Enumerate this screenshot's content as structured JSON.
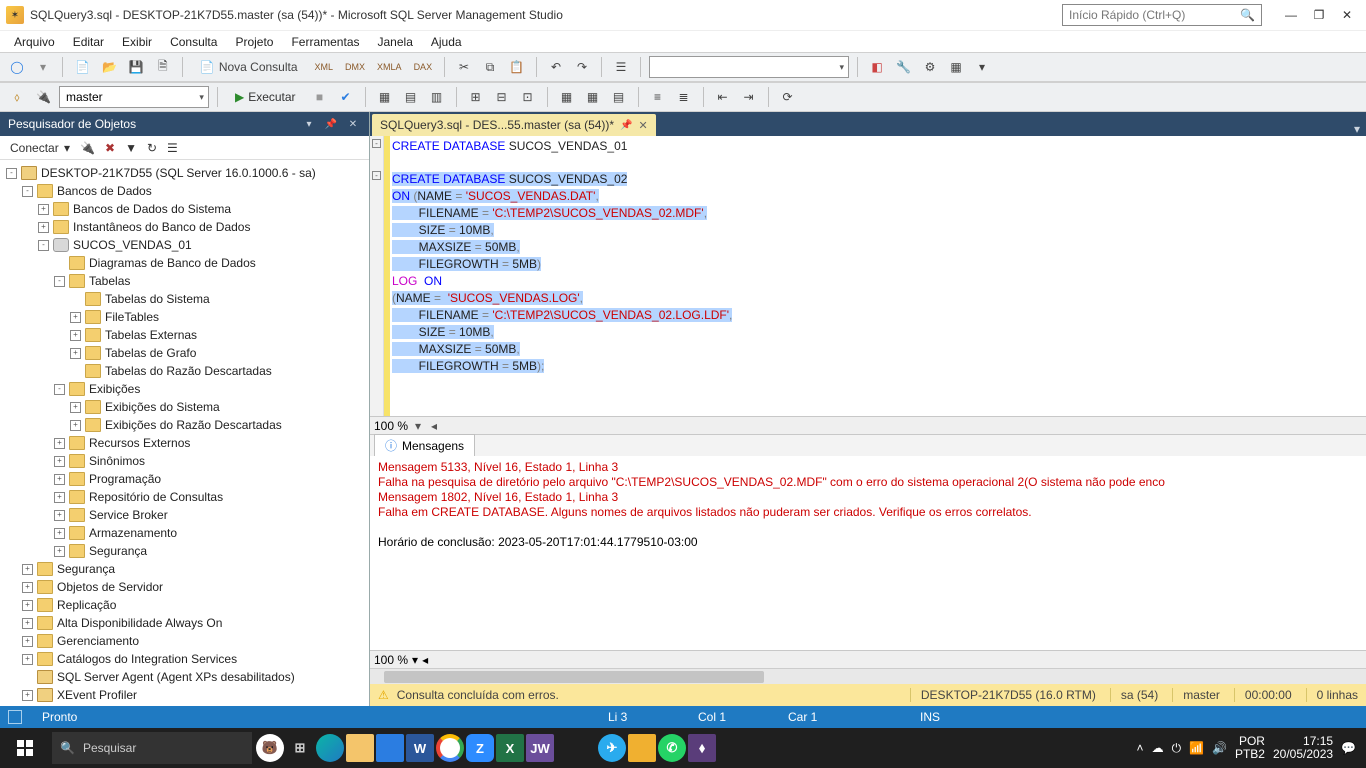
{
  "title": "SQLQuery3.sql - DESKTOP-21K7D55.master (sa (54))* - Microsoft SQL Server Management Studio",
  "quick_launch_placeholder": "Início Rápido (Ctrl+Q)",
  "menu": [
    "Arquivo",
    "Editar",
    "Exibir",
    "Consulta",
    "Projeto",
    "Ferramentas",
    "Janela",
    "Ajuda"
  ],
  "toolbar": {
    "new_query": "Nova Consulta",
    "execute": "Executar"
  },
  "db_combo": "master",
  "obj_explorer": {
    "title": "Pesquisador de Objetos",
    "connect": "Conectar",
    "tree": [
      {
        "pad": 0,
        "exp": "-",
        "icon": "srv",
        "label": "DESKTOP-21K7D55 (SQL Server 16.0.1000.6 - sa)"
      },
      {
        "pad": 1,
        "exp": "-",
        "icon": "f",
        "label": "Bancos de Dados"
      },
      {
        "pad": 2,
        "exp": "+",
        "icon": "f",
        "label": "Bancos de Dados do Sistema"
      },
      {
        "pad": 2,
        "exp": "+",
        "icon": "f",
        "label": "Instantâneos do Banco de Dados"
      },
      {
        "pad": 2,
        "exp": "-",
        "icon": "db",
        "label": "SUCOS_VENDAS_01"
      },
      {
        "pad": 3,
        "exp": "",
        "icon": "f",
        "label": "Diagramas de Banco de Dados"
      },
      {
        "pad": 3,
        "exp": "-",
        "icon": "f",
        "label": "Tabelas"
      },
      {
        "pad": 4,
        "exp": "",
        "icon": "f",
        "label": "Tabelas do Sistema"
      },
      {
        "pad": 4,
        "exp": "+",
        "icon": "f",
        "label": "FileTables"
      },
      {
        "pad": 4,
        "exp": "+",
        "icon": "f",
        "label": "Tabelas Externas"
      },
      {
        "pad": 4,
        "exp": "+",
        "icon": "f",
        "label": "Tabelas de Grafo"
      },
      {
        "pad": 4,
        "exp": "",
        "icon": "f",
        "label": "Tabelas do Razão Descartadas"
      },
      {
        "pad": 3,
        "exp": "-",
        "icon": "f",
        "label": "Exibições"
      },
      {
        "pad": 4,
        "exp": "+",
        "icon": "f",
        "label": "Exibições do Sistema"
      },
      {
        "pad": 4,
        "exp": "+",
        "icon": "f",
        "label": "Exibições do Razão Descartadas"
      },
      {
        "pad": 3,
        "exp": "+",
        "icon": "f",
        "label": "Recursos Externos"
      },
      {
        "pad": 3,
        "exp": "+",
        "icon": "f",
        "label": "Sinônimos"
      },
      {
        "pad": 3,
        "exp": "+",
        "icon": "f",
        "label": "Programação"
      },
      {
        "pad": 3,
        "exp": "+",
        "icon": "f",
        "label": "Repositório de Consultas"
      },
      {
        "pad": 3,
        "exp": "+",
        "icon": "f",
        "label": "Service Broker"
      },
      {
        "pad": 3,
        "exp": "+",
        "icon": "f",
        "label": "Armazenamento"
      },
      {
        "pad": 3,
        "exp": "+",
        "icon": "f",
        "label": "Segurança"
      },
      {
        "pad": 1,
        "exp": "+",
        "icon": "f",
        "label": "Segurança"
      },
      {
        "pad": 1,
        "exp": "+",
        "icon": "f",
        "label": "Objetos de Servidor"
      },
      {
        "pad": 1,
        "exp": "+",
        "icon": "f",
        "label": "Replicação"
      },
      {
        "pad": 1,
        "exp": "+",
        "icon": "f",
        "label": "Alta Disponibilidade Always On"
      },
      {
        "pad": 1,
        "exp": "+",
        "icon": "f",
        "label": "Gerenciamento"
      },
      {
        "pad": 1,
        "exp": "+",
        "icon": "f",
        "label": "Catálogos do Integration Services"
      },
      {
        "pad": 1,
        "exp": "",
        "icon": "srv",
        "label": "SQL Server Agent (Agent XPs desabilitados)"
      },
      {
        "pad": 1,
        "exp": "+",
        "icon": "srv",
        "label": "XEvent Profiler"
      }
    ]
  },
  "doc_tab": "SQLQuery3.sql - DES...55.master (sa (54))*",
  "code": {
    "l1": {
      "a": "CREATE DATABASE",
      "b": " SUCOS_VENDAS_01"
    },
    "l3": {
      "a": "CREATE DATABASE",
      "b": " SUCOS_VENDAS_02"
    },
    "l4": {
      "a": "ON ",
      "b": "(",
      "c": "NAME ",
      "d": "=",
      "e": " 'SUCOS_VENDAS.DAT'",
      "f": ","
    },
    "l5": {
      "a": "        FILENAME ",
      "b": "=",
      "c": " 'C:\\TEMP2\\SUCOS_VENDAS_02.MDF'",
      "d": ","
    },
    "l6": {
      "a": "        SIZE ",
      "b": "=",
      "c": " 10MB",
      "d": ","
    },
    "l7": {
      "a": "        MAXSIZE ",
      "b": "=",
      "c": " 50MB",
      "d": ","
    },
    "l8": {
      "a": "        FILEGROWTH ",
      "b": "=",
      "c": " 5MB",
      "d": ")"
    },
    "l9": {
      "a": "LOG",
      "b": "  ON"
    },
    "l10": {
      "a": "(",
      "b": "NAME ",
      "c": "=",
      "d": "  'SUCOS_VENDAS.LOG'",
      "e": ","
    },
    "l11": {
      "a": "        FILENAME ",
      "b": "=",
      "c": " 'C:\\TEMP2\\SUCOS_VENDAS_02.LOG.LDF'",
      "d": ","
    },
    "l12": {
      "a": "        SIZE ",
      "b": "=",
      "c": " 10MB",
      "d": ","
    },
    "l13": {
      "a": "        MAXSIZE ",
      "b": "=",
      "c": " 50MB",
      "d": ","
    },
    "l14": {
      "a": "        FILEGROWTH ",
      "b": "=",
      "c": " 5MB",
      "d": ");"
    }
  },
  "zoom": "100 %",
  "messages_tab": "Mensagens",
  "messages": {
    "l1": "Mensagem 5133, Nível 16, Estado 1, Linha 3",
    "l2": "Falha na pesquisa de diretório pelo arquivo \"C:\\TEMP2\\SUCOS_VENDAS_02.MDF\" com o erro do sistema operacional 2(O sistema não pode enco",
    "l3": "Mensagem 1802, Nível 16, Estado 1, Linha 3",
    "l4": "Falha em CREATE DATABASE. Alguns nomes de arquivos listados não puderam ser criados. Verifique os erros correlatos.",
    "l5": "",
    "l6": "Horário de conclusão: 2023-05-20T17:01:44.1779510-03:00"
  },
  "query_status": {
    "text": "Consulta concluída com erros.",
    "server": "DESKTOP-21K7D55 (16.0 RTM)",
    "user": "sa (54)",
    "db": "master",
    "time": "00:00:00",
    "rows": "0 linhas"
  },
  "ide_status": {
    "ready": "Pronto",
    "line": "Li 3",
    "col": "Col 1",
    "car": "Car 1",
    "ins": "INS"
  },
  "taskbar": {
    "search": "Pesquisar",
    "lang1": "POR",
    "lang2": "PTB2",
    "time": "17:15",
    "date": "20/05/2023"
  }
}
